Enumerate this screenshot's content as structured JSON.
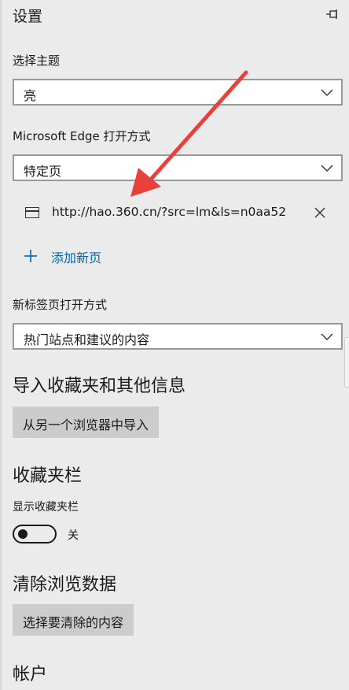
{
  "header": {
    "title": "设置",
    "pin_icon": "pin-icon"
  },
  "theme": {
    "label": "选择主题",
    "selected": "亮"
  },
  "startup": {
    "label": "Microsoft Edge 打开方式",
    "selected": "特定页",
    "pages": [
      {
        "url": "http://hao.360.cn/?src=lm&ls=n0aa52"
      }
    ],
    "add_page_label": "添加新页"
  },
  "new_tab": {
    "label": "新标签页打开方式",
    "selected": "热门站点和建议的内容"
  },
  "import": {
    "heading": "导入收藏夹和其他信息",
    "button_label": "从另一个浏览器中导入"
  },
  "favorites_bar": {
    "heading": "收藏夹栏",
    "toggle_label": "显示收藏夹栏",
    "toggle_state": "关"
  },
  "clear_data": {
    "heading": "清除浏览数据",
    "button_label": "选择要清除的内容"
  },
  "account": {
    "heading": "帐户"
  },
  "colors": {
    "panel_bg": "#ebebeb",
    "link": "#0063b1",
    "annotation_arrow": "#e8403a"
  }
}
